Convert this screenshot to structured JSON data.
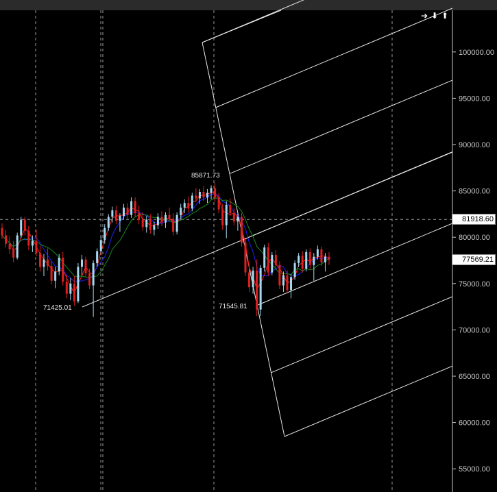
{
  "toolbar": {
    "right_icon": "right-arrow-icon",
    "down_icon": "down-arrow-icon",
    "up_icon": "up-arrow-icon",
    "right_glyph": "➔",
    "down_glyph": "⬇",
    "up_glyph": "⬆"
  },
  "chart_data": {
    "type": "candlestick",
    "y_axis": {
      "ylim": [
        52500,
        104500
      ],
      "ticks": [
        {
          "value": 100000,
          "label": "100000.00"
        },
        {
          "value": 95000,
          "label": "95000.00"
        },
        {
          "value": 90000,
          "label": "90000.00"
        },
        {
          "value": 85000,
          "label": "85000.00"
        },
        {
          "value": 80000,
          "label": "80000.00"
        },
        {
          "value": 75000,
          "label": "75000.00"
        },
        {
          "value": 70000,
          "label": "70000.00"
        },
        {
          "value": 65000,
          "label": "65000.00"
        },
        {
          "value": 60000,
          "label": "60000.00"
        },
        {
          "value": 55000,
          "label": "55000.00"
        }
      ],
      "side": "right"
    },
    "crosshair_value": "81918.60",
    "last_price": "77569.21",
    "annotations": [
      {
        "text": "71425.01",
        "value": 71425.01
      },
      {
        "text": "85871.73",
        "value": 85871.73
      },
      {
        "text": "71545.81",
        "value": 71545.81
      }
    ],
    "colors": {
      "background": "#000000",
      "up_candle": "#a8d8f0",
      "down_candle": "#e02020",
      "ma_fast": "#ff2020",
      "ma_mid": "#2020ff",
      "ma_slow": "#1a8a1a",
      "channel": "#e8e8e8",
      "grid": "#9a9a9a"
    },
    "candles": [
      [
        81000,
        81500,
        79800,
        80200
      ],
      [
        80200,
        80800,
        78900,
        79300
      ],
      [
        79300,
        80100,
        78200,
        78700
      ],
      [
        78700,
        79600,
        77300,
        77800
      ],
      [
        77800,
        80500,
        77600,
        80200
      ],
      [
        80200,
        82200,
        79900,
        81900
      ],
      [
        81900,
        82200,
        80200,
        80700
      ],
      [
        80700,
        81200,
        78600,
        79100
      ],
      [
        79100,
        80200,
        78400,
        79600
      ],
      [
        79600,
        80800,
        78000,
        78300
      ],
      [
        78300,
        79100,
        76300,
        76800
      ],
      [
        76800,
        78200,
        75800,
        77600
      ],
      [
        77600,
        78800,
        76400,
        76900
      ],
      [
        76900,
        77400,
        74900,
        75300
      ],
      [
        75300,
        76800,
        74500,
        76300
      ],
      [
        76300,
        78200,
        75900,
        77800
      ],
      [
        77800,
        78400,
        74800,
        75200
      ],
      [
        75200,
        75900,
        73400,
        73900
      ],
      [
        73900,
        75600,
        73200,
        75000
      ],
      [
        75000,
        75800,
        72600,
        73100
      ],
      [
        73100,
        77200,
        72900,
        76800
      ],
      [
        76800,
        78100,
        75900,
        77600
      ],
      [
        77600,
        77900,
        75700,
        76100
      ],
      [
        76100,
        76600,
        74400,
        74800
      ],
      [
        74800,
        77500,
        71400,
        77200
      ],
      [
        77200,
        78800,
        76800,
        78500
      ],
      [
        78500,
        80100,
        78100,
        79700
      ],
      [
        79700,
        81400,
        79300,
        81000
      ],
      [
        81000,
        82500,
        80700,
        82200
      ],
      [
        82200,
        83300,
        81600,
        82900
      ],
      [
        82900,
        83400,
        81400,
        81800
      ],
      [
        81800,
        82600,
        80600,
        82300
      ],
      [
        82300,
        83600,
        81900,
        83200
      ],
      [
        83200,
        83700,
        82000,
        82400
      ],
      [
        82400,
        84300,
        82100,
        83900
      ],
      [
        83900,
        84300,
        82200,
        82600
      ],
      [
        82600,
        83400,
        81400,
        81900
      ],
      [
        81900,
        82700,
        80700,
        81100
      ],
      [
        81100,
        82300,
        80500,
        81900
      ],
      [
        81900,
        82500,
        80400,
        80800
      ],
      [
        80800,
        81700,
        80200,
        81300
      ],
      [
        81300,
        82600,
        80900,
        82200
      ],
      [
        82200,
        82800,
        81200,
        81600
      ],
      [
        81600,
        82700,
        81000,
        82400
      ],
      [
        82400,
        83200,
        81700,
        82000
      ],
      [
        82000,
        82600,
        80200,
        80600
      ],
      [
        80600,
        82700,
        80300,
        82400
      ],
      [
        82400,
        83600,
        81900,
        83200
      ],
      [
        83200,
        84100,
        82600,
        83700
      ],
      [
        83700,
        84400,
        82700,
        83100
      ],
      [
        83100,
        84800,
        82800,
        84500
      ],
      [
        84500,
        85300,
        83800,
        84200
      ],
      [
        84200,
        85200,
        83600,
        84900
      ],
      [
        84900,
        85500,
        83900,
        84300
      ],
      [
        84300,
        85200,
        83700,
        84800
      ],
      [
        84800,
        85600,
        84100,
        85300
      ],
      [
        85300,
        85900,
        83800,
        84300
      ],
      [
        84300,
        84800,
        82600,
        83000
      ],
      [
        83000,
        83600,
        80800,
        81300
      ],
      [
        81300,
        83900,
        79900,
        83500
      ],
      [
        83500,
        84200,
        82300,
        82600
      ],
      [
        82600,
        83100,
        81300,
        81700
      ],
      [
        81700,
        82600,
        80700,
        82200
      ],
      [
        82200,
        82600,
        79000,
        79400
      ],
      [
        79400,
        79800,
        75800,
        76200
      ],
      [
        76200,
        77100,
        74100,
        74600
      ],
      [
        74600,
        76800,
        73900,
        76400
      ],
      [
        76400,
        77600,
        71500,
        72200
      ],
      [
        72200,
        77000,
        71500,
        76700
      ],
      [
        76700,
        79200,
        76300,
        78900
      ],
      [
        78900,
        79400,
        75800,
        76200
      ],
      [
        76200,
        78400,
        75900,
        78100
      ],
      [
        78100,
        78600,
        76600,
        77000
      ],
      [
        77000,
        77400,
        74400,
        74800
      ],
      [
        74800,
        76300,
        74100,
        75900
      ],
      [
        75900,
        76400,
        73900,
        74300
      ],
      [
        74300,
        76000,
        73400,
        75700
      ],
      [
        75700,
        77500,
        75400,
        77200
      ],
      [
        77200,
        78300,
        76800,
        78000
      ],
      [
        78000,
        78500,
        76200,
        76600
      ],
      [
        76600,
        78700,
        76300,
        78400
      ],
      [
        78400,
        78800,
        76600,
        77000
      ],
      [
        77000,
        78300,
        75300,
        77900
      ],
      [
        77900,
        79100,
        77600,
        78700
      ],
      [
        78700,
        79000,
        76900,
        77300
      ],
      [
        77300,
        78300,
        76300,
        77900
      ],
      [
        77900,
        78400,
        77000,
        77569
      ]
    ]
  }
}
